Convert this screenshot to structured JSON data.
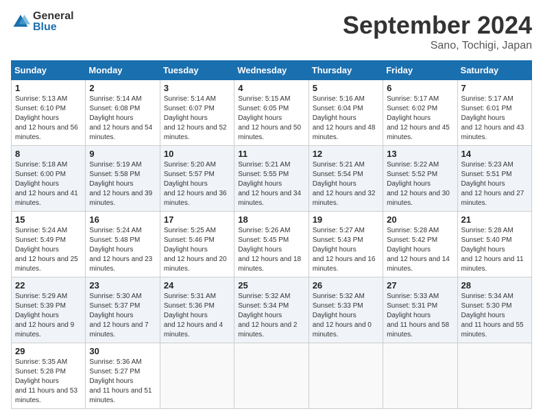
{
  "header": {
    "logo_general": "General",
    "logo_blue": "Blue",
    "month_title": "September 2024",
    "location": "Sano, Tochigi, Japan"
  },
  "weekdays": [
    "Sunday",
    "Monday",
    "Tuesday",
    "Wednesday",
    "Thursday",
    "Friday",
    "Saturday"
  ],
  "weeks": [
    [
      {
        "day": "1",
        "sunrise": "5:13 AM",
        "sunset": "6:10 PM",
        "daylight": "12 hours and 56 minutes."
      },
      {
        "day": "2",
        "sunrise": "5:14 AM",
        "sunset": "6:08 PM",
        "daylight": "12 hours and 54 minutes."
      },
      {
        "day": "3",
        "sunrise": "5:14 AM",
        "sunset": "6:07 PM",
        "daylight": "12 hours and 52 minutes."
      },
      {
        "day": "4",
        "sunrise": "5:15 AM",
        "sunset": "6:05 PM",
        "daylight": "12 hours and 50 minutes."
      },
      {
        "day": "5",
        "sunrise": "5:16 AM",
        "sunset": "6:04 PM",
        "daylight": "12 hours and 48 minutes."
      },
      {
        "day": "6",
        "sunrise": "5:17 AM",
        "sunset": "6:02 PM",
        "daylight": "12 hours and 45 minutes."
      },
      {
        "day": "7",
        "sunrise": "5:17 AM",
        "sunset": "6:01 PM",
        "daylight": "12 hours and 43 minutes."
      }
    ],
    [
      {
        "day": "8",
        "sunrise": "5:18 AM",
        "sunset": "6:00 PM",
        "daylight": "12 hours and 41 minutes."
      },
      {
        "day": "9",
        "sunrise": "5:19 AM",
        "sunset": "5:58 PM",
        "daylight": "12 hours and 39 minutes."
      },
      {
        "day": "10",
        "sunrise": "5:20 AM",
        "sunset": "5:57 PM",
        "daylight": "12 hours and 36 minutes."
      },
      {
        "day": "11",
        "sunrise": "5:21 AM",
        "sunset": "5:55 PM",
        "daylight": "12 hours and 34 minutes."
      },
      {
        "day": "12",
        "sunrise": "5:21 AM",
        "sunset": "5:54 PM",
        "daylight": "12 hours and 32 minutes."
      },
      {
        "day": "13",
        "sunrise": "5:22 AM",
        "sunset": "5:52 PM",
        "daylight": "12 hours and 30 minutes."
      },
      {
        "day": "14",
        "sunrise": "5:23 AM",
        "sunset": "5:51 PM",
        "daylight": "12 hours and 27 minutes."
      }
    ],
    [
      {
        "day": "15",
        "sunrise": "5:24 AM",
        "sunset": "5:49 PM",
        "daylight": "12 hours and 25 minutes."
      },
      {
        "day": "16",
        "sunrise": "5:24 AM",
        "sunset": "5:48 PM",
        "daylight": "12 hours and 23 minutes."
      },
      {
        "day": "17",
        "sunrise": "5:25 AM",
        "sunset": "5:46 PM",
        "daylight": "12 hours and 20 minutes."
      },
      {
        "day": "18",
        "sunrise": "5:26 AM",
        "sunset": "5:45 PM",
        "daylight": "12 hours and 18 minutes."
      },
      {
        "day": "19",
        "sunrise": "5:27 AM",
        "sunset": "5:43 PM",
        "daylight": "12 hours and 16 minutes."
      },
      {
        "day": "20",
        "sunrise": "5:28 AM",
        "sunset": "5:42 PM",
        "daylight": "12 hours and 14 minutes."
      },
      {
        "day": "21",
        "sunrise": "5:28 AM",
        "sunset": "5:40 PM",
        "daylight": "12 hours and 11 minutes."
      }
    ],
    [
      {
        "day": "22",
        "sunrise": "5:29 AM",
        "sunset": "5:39 PM",
        "daylight": "12 hours and 9 minutes."
      },
      {
        "day": "23",
        "sunrise": "5:30 AM",
        "sunset": "5:37 PM",
        "daylight": "12 hours and 7 minutes."
      },
      {
        "day": "24",
        "sunrise": "5:31 AM",
        "sunset": "5:36 PM",
        "daylight": "12 hours and 4 minutes."
      },
      {
        "day": "25",
        "sunrise": "5:32 AM",
        "sunset": "5:34 PM",
        "daylight": "12 hours and 2 minutes."
      },
      {
        "day": "26",
        "sunrise": "5:32 AM",
        "sunset": "5:33 PM",
        "daylight": "12 hours and 0 minutes."
      },
      {
        "day": "27",
        "sunrise": "5:33 AM",
        "sunset": "5:31 PM",
        "daylight": "11 hours and 58 minutes."
      },
      {
        "day": "28",
        "sunrise": "5:34 AM",
        "sunset": "5:30 PM",
        "daylight": "11 hours and 55 minutes."
      }
    ],
    [
      {
        "day": "29",
        "sunrise": "5:35 AM",
        "sunset": "5:28 PM",
        "daylight": "11 hours and 53 minutes."
      },
      {
        "day": "30",
        "sunrise": "5:36 AM",
        "sunset": "5:27 PM",
        "daylight": "11 hours and 51 minutes."
      },
      null,
      null,
      null,
      null,
      null
    ]
  ]
}
